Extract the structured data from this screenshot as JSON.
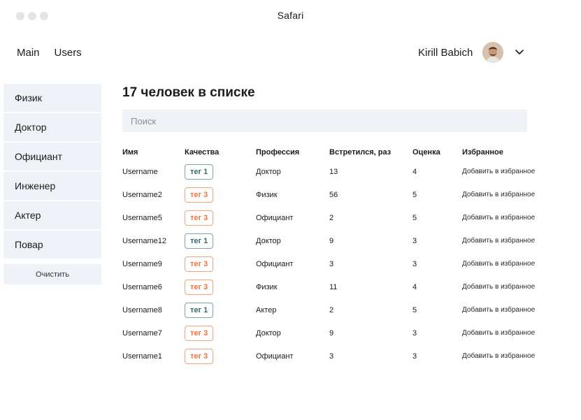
{
  "window": {
    "title": "Safari"
  },
  "nav": {
    "main": "Main",
    "users": "Users"
  },
  "user": {
    "name": "Kirill Babich"
  },
  "sidebar": {
    "items": [
      "Физик",
      "Доктор",
      "Официант",
      "Инженер",
      "Актер",
      "Повар"
    ],
    "clear": "Очистить"
  },
  "main": {
    "heading": "17 человек в списке",
    "search_placeholder": "Поиск",
    "columns": [
      "Имя",
      "Качества",
      "Профессия",
      "Встретился, раз",
      "Оценка",
      "Избранное"
    ],
    "rows": [
      {
        "name": "Username",
        "tag": "тег 1",
        "tag_kind": 1,
        "profession": "Доктор",
        "met": "13",
        "score": "4",
        "fav": "Добавить в избранное"
      },
      {
        "name": "Username2",
        "tag": "тег 3",
        "tag_kind": 3,
        "profession": "Физик",
        "met": "56",
        "score": "5",
        "fav": "Добавить в избранное"
      },
      {
        "name": "Username5",
        "tag": "тег 3",
        "tag_kind": 3,
        "profession": "Официант",
        "met": "2",
        "score": "5",
        "fav": "Добавить в избранное"
      },
      {
        "name": "Username12",
        "tag": "тег 1",
        "tag_kind": 1,
        "profession": "Доктор",
        "met": "9",
        "score": "3",
        "fav": "Добавить в избранное"
      },
      {
        "name": "Username9",
        "tag": "тег 3",
        "tag_kind": 3,
        "profession": "Официант",
        "met": "3",
        "score": "3",
        "fav": "Добавить в избранное"
      },
      {
        "name": "Username6",
        "tag": "тег 3",
        "tag_kind": 3,
        "profession": "Физик",
        "met": "11",
        "score": "4",
        "fav": "Добавить в избранное"
      },
      {
        "name": "Username8",
        "tag": "тег 1",
        "tag_kind": 1,
        "profession": "Актер",
        "met": "2",
        "score": "5",
        "fav": "Добавить в избранное"
      },
      {
        "name": "Username7",
        "tag": "тег 3",
        "tag_kind": 3,
        "profession": "Доктор",
        "met": "9",
        "score": "3",
        "fav": "Добавить в избранное"
      },
      {
        "name": "Username1",
        "tag": "тег 3",
        "tag_kind": 3,
        "profession": "Официант",
        "met": "3",
        "score": "3",
        "fav": "Добавить в избранное"
      }
    ]
  },
  "icons": {
    "window_controls": "traffic-lights",
    "user_menu": "chevron-down-icon",
    "avatar": "user-avatar"
  },
  "colors": {
    "panel_bg": "#eff2f7",
    "tag1": "#2f6f6b",
    "tag3": "#f0733e"
  }
}
